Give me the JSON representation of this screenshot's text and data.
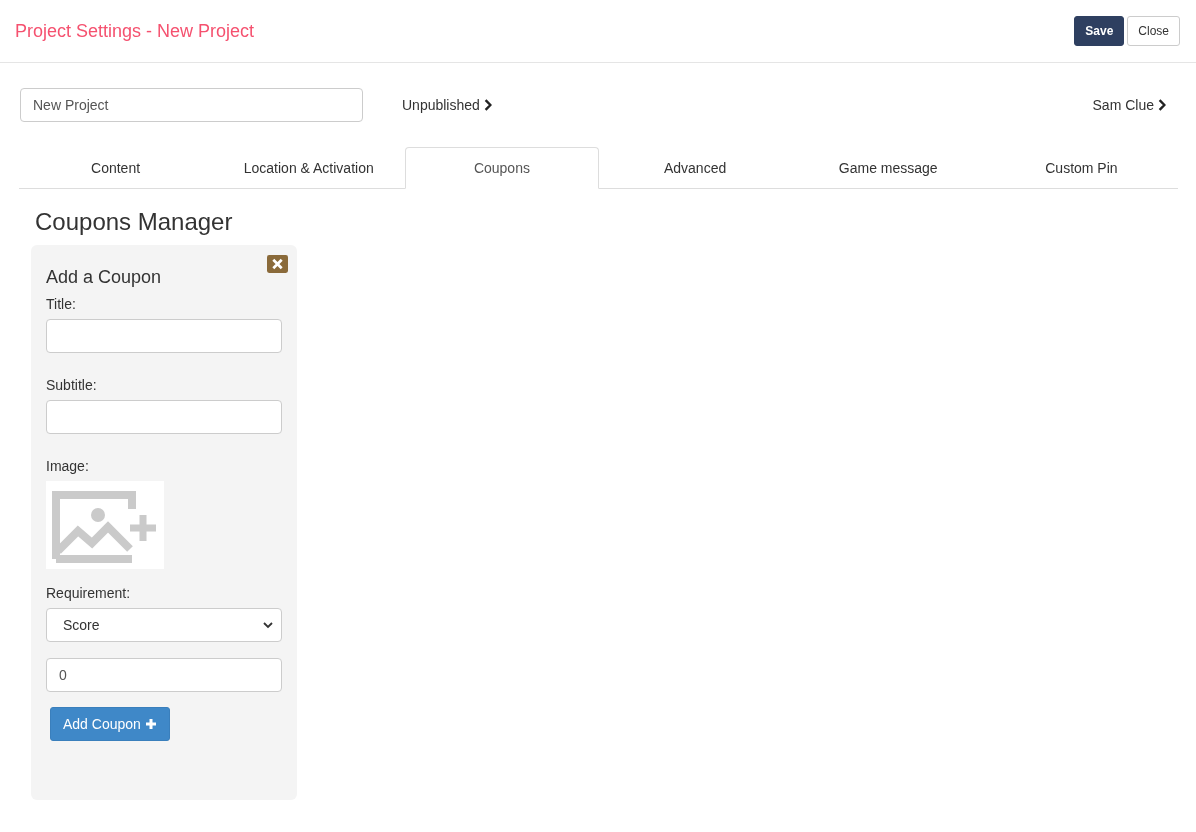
{
  "header": {
    "title": "Project Settings - New Project",
    "buttons": [
      {
        "label": "Save",
        "kind": "primary"
      },
      {
        "label": "Close",
        "kind": "default"
      }
    ]
  },
  "project": {
    "name_value": "New Project",
    "status": "Unpublished",
    "owner": "Sam Clue"
  },
  "tabs": [
    {
      "label": "Content",
      "selected": false
    },
    {
      "label": "Location & Activation",
      "selected": false
    },
    {
      "label": "Coupons",
      "selected": true
    },
    {
      "label": "Advanced",
      "selected": false
    },
    {
      "label": "Game message",
      "selected": false
    },
    {
      "label": "Custom Pin",
      "selected": false
    }
  ],
  "section_title": "Coupons Manager",
  "coupon_form": {
    "title": "Add a Coupon",
    "title_label": "Title:",
    "subtitle_label": "Subtitle:",
    "image_label": "Image:",
    "requirement_label": "Requirement:",
    "requirement_value": "Score",
    "amount_value": "0",
    "submit": "Add Coupon"
  }
}
